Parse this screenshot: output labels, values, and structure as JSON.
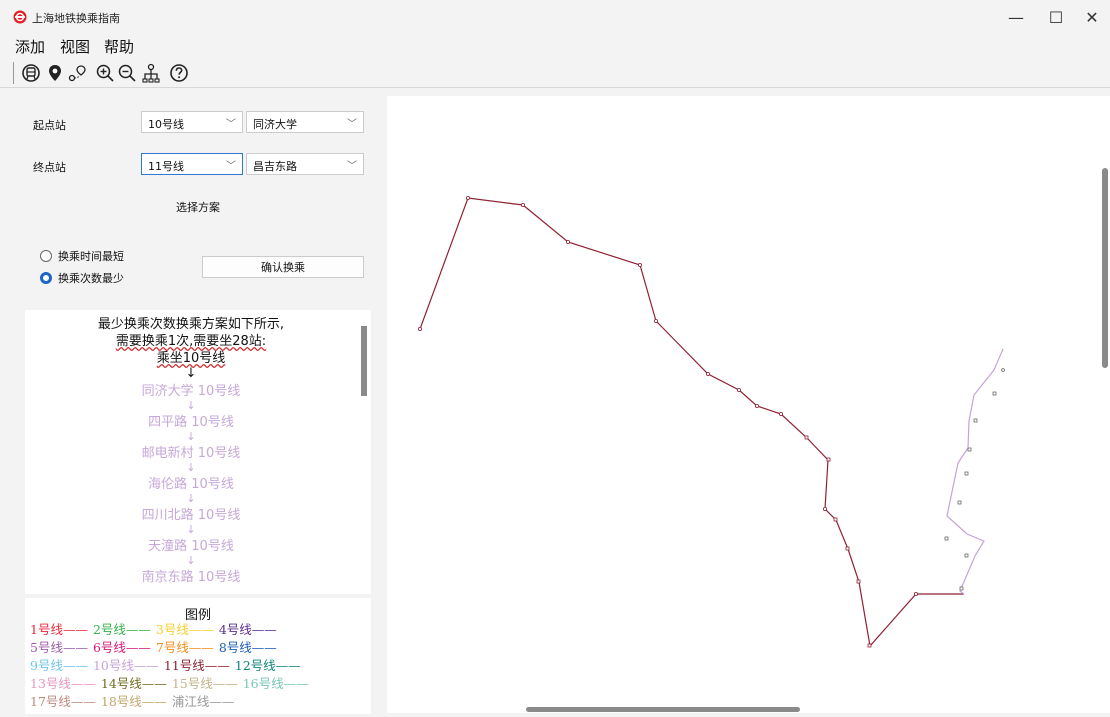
{
  "window": {
    "title": "上海地铁换乘指南",
    "minimize_label": "—",
    "maximize_label": "☐",
    "close_label": "✕"
  },
  "menu": [
    "添加",
    "视图",
    "帮助"
  ],
  "toolbar": {
    "icons": [
      "metro-icon",
      "location-pin-icon",
      "route-icon",
      "zoom-in-icon",
      "zoom-out-icon",
      "network-icon",
      "help-icon"
    ]
  },
  "form": {
    "start_label": "起点站",
    "start_line": "10号线",
    "start_station": "同济大学",
    "end_label": "终点站",
    "end_line": "11号线",
    "end_station": "昌吉东路",
    "scheme_label": "选择方案",
    "option_shortest": "换乘时间最短",
    "option_fewest": "换乘次数最少",
    "selected_option": "换乘次数最少",
    "confirm_button": "确认换乘"
  },
  "result": {
    "heading": "最少换乘次数换乘方案如下所示,",
    "summary": "需要换乘1次,需要坐28站:",
    "ride": "乘坐10号线",
    "arrow": "↓",
    "stops": [
      "同济大学 10号线",
      "四平路 10号线",
      "邮电新村 10号线",
      "海伦路 10号线",
      "四川北路 10号线",
      "天潼路 10号线",
      "南京东路 10号线"
    ]
  },
  "legend": {
    "title": "图例",
    "rows": [
      [
        {
          "text": "1号线——",
          "color": "#e8283c"
        },
        {
          "text": "2号线——",
          "color": "#36b04a"
        },
        {
          "text": "3号线——",
          "color": "#f6d02e"
        },
        {
          "text": "4号线——",
          "color": "#5a2f8e"
        }
      ],
      [
        {
          "text": "5号线——",
          "color": "#9c5ea8"
        },
        {
          "text": "6号线——",
          "color": "#d6197c"
        },
        {
          "text": "7号线——",
          "color": "#f28d1a"
        },
        {
          "text": "8号线——",
          "color": "#1d5fb8"
        }
      ],
      [
        {
          "text": "9号线——",
          "color": "#71c5e8"
        },
        {
          "text": "10号线——",
          "color": "#c5a3d9"
        },
        {
          "text": "11号线——",
          "color": "#8e2133"
        },
        {
          "text": "12号线——",
          "color": "#11857a"
        }
      ],
      [
        {
          "text": "13号线——",
          "color": "#e897c0"
        },
        {
          "text": "14号线——",
          "color": "#726d20"
        },
        {
          "text": "15号线——",
          "color": "#c3b38a"
        },
        {
          "text": "16号线——",
          "color": "#78c7b7"
        }
      ],
      [
        {
          "text": "17号线——",
          "color": "#bc8b7d"
        },
        {
          "text": "18号线——",
          "color": "#c3a66a"
        },
        {
          "text": "浦江线——",
          "color": "#999999"
        }
      ]
    ]
  },
  "map": {
    "line11_color": "#8e2133",
    "line10_color": "#c5a3d9"
  }
}
